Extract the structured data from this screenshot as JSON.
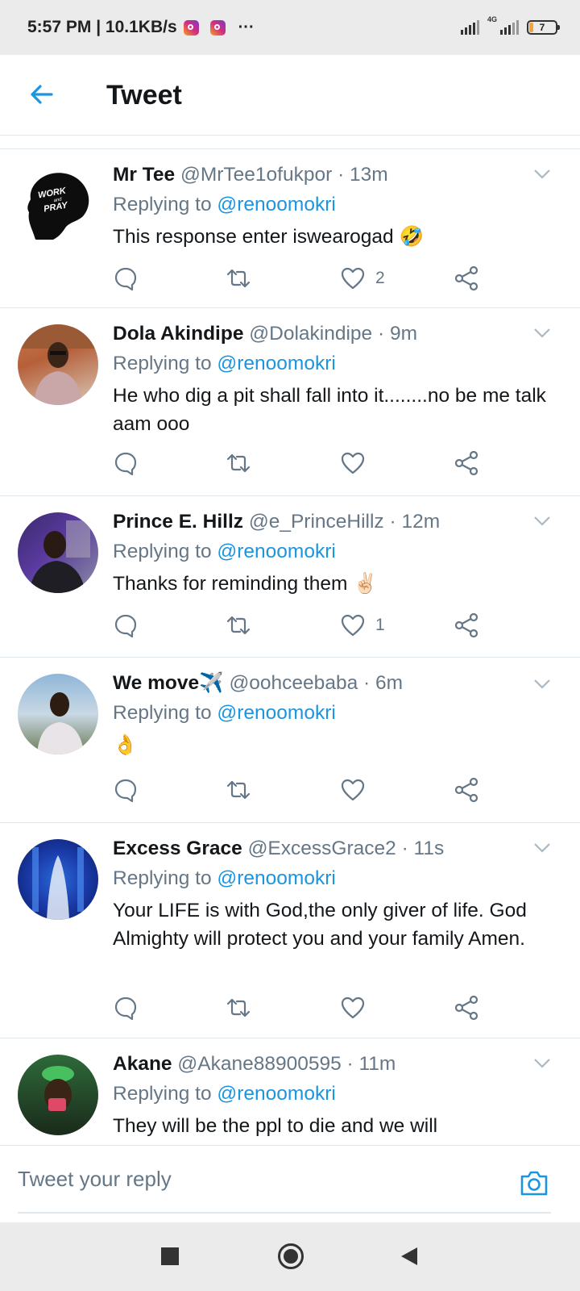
{
  "status_bar": {
    "time_speed": "5:57 PM | 10.1KB/s",
    "overflow": "···",
    "network": "4G",
    "battery": "7"
  },
  "header": {
    "title": "Tweet"
  },
  "tweets": [
    {
      "name": "Mr Tee",
      "handle": "@MrTee1ofukpor",
      "time": "· 13m",
      "replying_prefix": "Replying to",
      "mention": "@renoomokri",
      "body": "This response enter iswearogad 🤣",
      "likes": "2",
      "avatar_text": "WORK and PRAY"
    },
    {
      "name": "Dola Akindipe",
      "handle": "@Dolakindipe",
      "time": "· 9m",
      "replying_prefix": "Replying to",
      "mention": "@renoomokri",
      "body": "He who dig a pit shall fall into it........no be me talk aam ooo",
      "likes": ""
    },
    {
      "name": "Prince E. Hillz",
      "handle": "@e_PrinceHillz",
      "time": "· 12m",
      "replying_prefix": "Replying to",
      "mention": "@renoomokri",
      "body": "Thanks for reminding them ✌🏻",
      "likes": "1"
    },
    {
      "name": "We move✈️",
      "handle": "@oohceebaba",
      "time": "· 6m",
      "replying_prefix": "Replying to",
      "mention": "@renoomokri",
      "body": "👌",
      "likes": ""
    },
    {
      "name": "Excess Grace",
      "handle": "@ExcessGrace2",
      "time": "· 11s",
      "replying_prefix": "Replying to",
      "mention": "@renoomokri",
      "body": "Your LIFE is with God,the only giver of life. God Almighty will protect you and your family Amen.",
      "likes": ""
    },
    {
      "name": "Akane",
      "handle": "@Akane88900595",
      "time": "· 11m",
      "replying_prefix": "Replying to",
      "mention": "@renoomokri",
      "body": "They will be the ppl to die and we will",
      "likes": ""
    }
  ],
  "reply_bar": {
    "placeholder": "Tweet your reply"
  },
  "icons": {
    "back": "arrow-left-icon",
    "reply": "comment-icon",
    "retweet": "retweet-icon",
    "like": "heart-icon",
    "share": "share-icon",
    "camera": "camera-icon"
  },
  "colors": {
    "accent": "#1b95e0",
    "secondary_text": "#657786",
    "divider": "#e1e8ed"
  }
}
